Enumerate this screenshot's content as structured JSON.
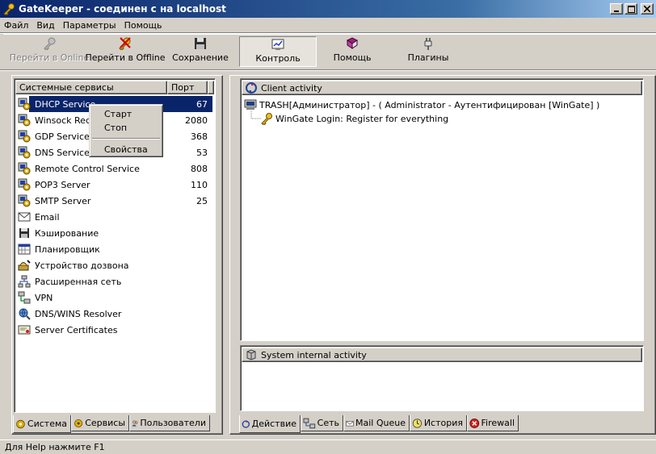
{
  "window": {
    "title": "GateKeeper - соединен с на localhost",
    "min_icon": "minimize-icon",
    "max_icon": "maximize-icon",
    "close_icon": "close-icon"
  },
  "menubar": {
    "items": [
      "Файл",
      "Вид",
      "Параметры",
      "Помощь"
    ]
  },
  "toolbar": {
    "buttons": [
      {
        "label": "Перейти в Online",
        "icon": "key-icon",
        "enabled": false
      },
      {
        "label": "Перейти в Offline",
        "icon": "key-cross-icon",
        "enabled": true
      },
      {
        "label": "Сохранение",
        "icon": "floppy-disk-icon",
        "enabled": true
      },
      {
        "label": "Контроль",
        "icon": "monitor-chart-icon",
        "enabled": true,
        "pressed": true
      },
      {
        "label": "Помощь",
        "icon": "help-book-icon",
        "enabled": true
      },
      {
        "label": "Плагины",
        "icon": "plug-icon",
        "enabled": true
      }
    ]
  },
  "services_list": {
    "headers": {
      "name": "Системные сервисы",
      "port": "Порт"
    },
    "rows": [
      {
        "name": "DHCP Service",
        "port": "67",
        "icon": "service-gear-icon",
        "selected": true
      },
      {
        "name": "Winsock Redi",
        "port": "2080",
        "icon": "service-gear-icon"
      },
      {
        "name": "GDP Service",
        "port": "368",
        "icon": "service-gear-icon"
      },
      {
        "name": "DNS Service",
        "port": "53",
        "icon": "service-gear-icon"
      },
      {
        "name": "Remote Control Service",
        "port": "808",
        "icon": "service-gear-icon"
      },
      {
        "name": "POP3 Server",
        "port": "110",
        "icon": "service-gear-icon"
      },
      {
        "name": "SMTP Server",
        "port": "25",
        "icon": "service-gear-icon"
      },
      {
        "name": "Email",
        "port": "",
        "icon": "email-icon"
      },
      {
        "name": "Кэширование",
        "port": "",
        "icon": "cache-disk-icon"
      },
      {
        "name": "Планировщик",
        "port": "",
        "icon": "scheduler-icon"
      },
      {
        "name": "Устройство дозвона",
        "port": "",
        "icon": "dialer-icon"
      },
      {
        "name": "Расширенная сеть",
        "port": "",
        "icon": "network-icon"
      },
      {
        "name": "VPN",
        "port": "",
        "icon": "vpn-icon"
      },
      {
        "name": "DNS/WINS Resolver",
        "port": "",
        "icon": "resolver-icon"
      },
      {
        "name": "Server Certificates",
        "port": "",
        "icon": "certificate-icon"
      }
    ]
  },
  "context_menu": {
    "items": [
      "Старт",
      "Стоп",
      "Свойства"
    ]
  },
  "left_tabs": [
    {
      "label": "Система",
      "icon": "system-icon",
      "active": true
    },
    {
      "label": "Сервисы",
      "icon": "services-icon"
    },
    {
      "label": "Пользователи",
      "icon": "users-icon"
    }
  ],
  "client_activity": {
    "header": "Client activity",
    "entry": "TRASH[Администратор]  -  ( Administrator  -  Аутентифицирован [WinGate] )",
    "sub_entry": "WinGate Login: Register for everything"
  },
  "system_activity": {
    "header": "System internal activity"
  },
  "right_tabs": [
    {
      "label": "Действие",
      "icon": "action-icon",
      "active": true
    },
    {
      "label": "Сеть",
      "icon": "network-tab-icon"
    },
    {
      "label": "Mail Queue",
      "icon": "mail-queue-icon"
    },
    {
      "label": "История",
      "icon": "history-icon"
    },
    {
      "label": "Firewall",
      "icon": "firewall-icon"
    }
  ],
  "statusbar": {
    "text": "Для Help нажмите F1"
  }
}
